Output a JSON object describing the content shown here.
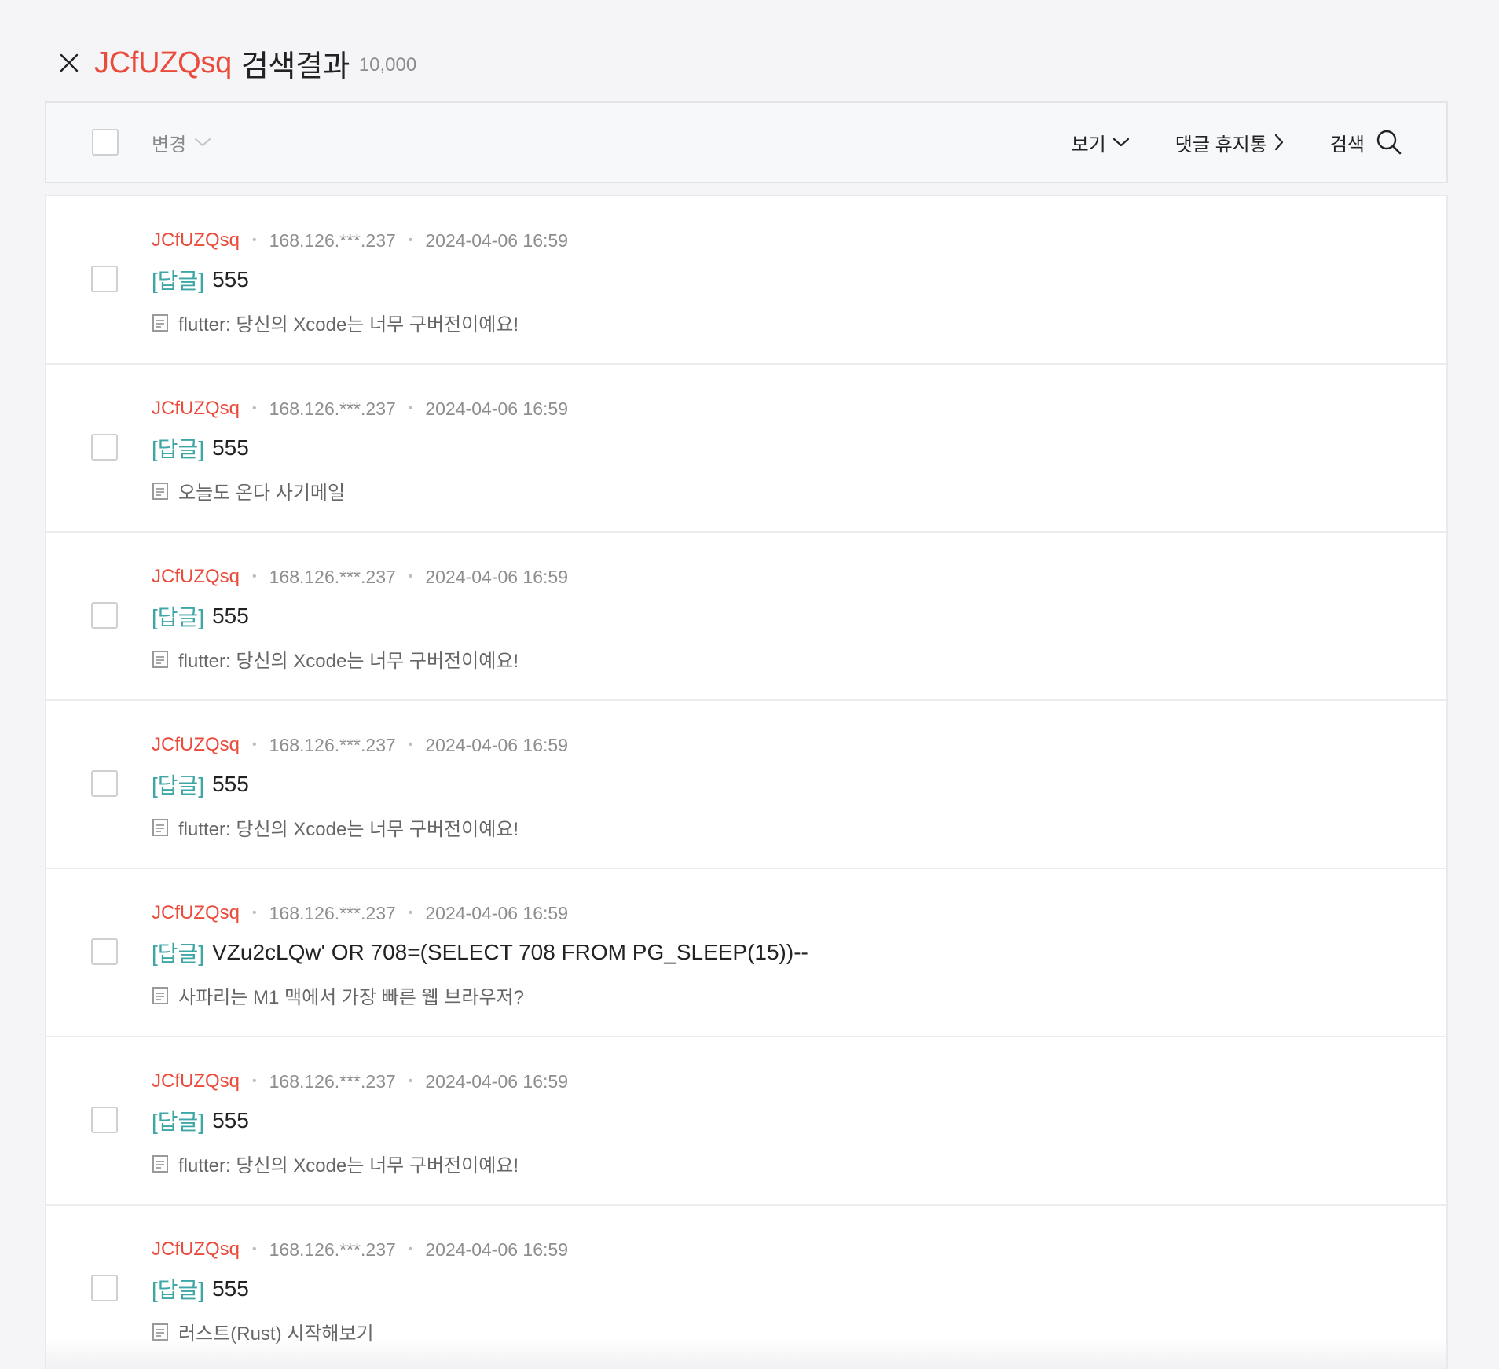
{
  "header": {
    "keyword": "JCfUZQsq",
    "suffix": "검색결과",
    "count": "10,000"
  },
  "toolbar": {
    "change_label": "변경",
    "view_label": "보기",
    "trash_label": "댓글 휴지통",
    "search_label": "검색"
  },
  "colors": {
    "accent": "#ea4c3c",
    "tag": "#3fa6a6"
  },
  "comments": [
    {
      "author": "JCfUZQsq",
      "ip": "168.126.***.237",
      "date": "2024-04-06 16:59",
      "tag": "[답글]",
      "title": "555",
      "post": "flutter: 당신의 Xcode는 너무 구버전이예요!"
    },
    {
      "author": "JCfUZQsq",
      "ip": "168.126.***.237",
      "date": "2024-04-06 16:59",
      "tag": "[답글]",
      "title": "555",
      "post": "오늘도 온다 사기메일"
    },
    {
      "author": "JCfUZQsq",
      "ip": "168.126.***.237",
      "date": "2024-04-06 16:59",
      "tag": "[답글]",
      "title": "555",
      "post": "flutter: 당신의 Xcode는 너무 구버전이예요!"
    },
    {
      "author": "JCfUZQsq",
      "ip": "168.126.***.237",
      "date": "2024-04-06 16:59",
      "tag": "[답글]",
      "title": "555",
      "post": "flutter: 당신의 Xcode는 너무 구버전이예요!"
    },
    {
      "author": "JCfUZQsq",
      "ip": "168.126.***.237",
      "date": "2024-04-06 16:59",
      "tag": "[답글]",
      "title": "VZu2cLQw' OR 708=(SELECT 708 FROM PG_SLEEP(15))--",
      "post": "사파리는 M1 맥에서 가장 빠른 웹 브라우저?"
    },
    {
      "author": "JCfUZQsq",
      "ip": "168.126.***.237",
      "date": "2024-04-06 16:59",
      "tag": "[답글]",
      "title": "555",
      "post": "flutter: 당신의 Xcode는 너무 구버전이예요!"
    },
    {
      "author": "JCfUZQsq",
      "ip": "168.126.***.237",
      "date": "2024-04-06 16:59",
      "tag": "[답글]",
      "title": "555",
      "post": "러스트(Rust) 시작해보기"
    }
  ]
}
